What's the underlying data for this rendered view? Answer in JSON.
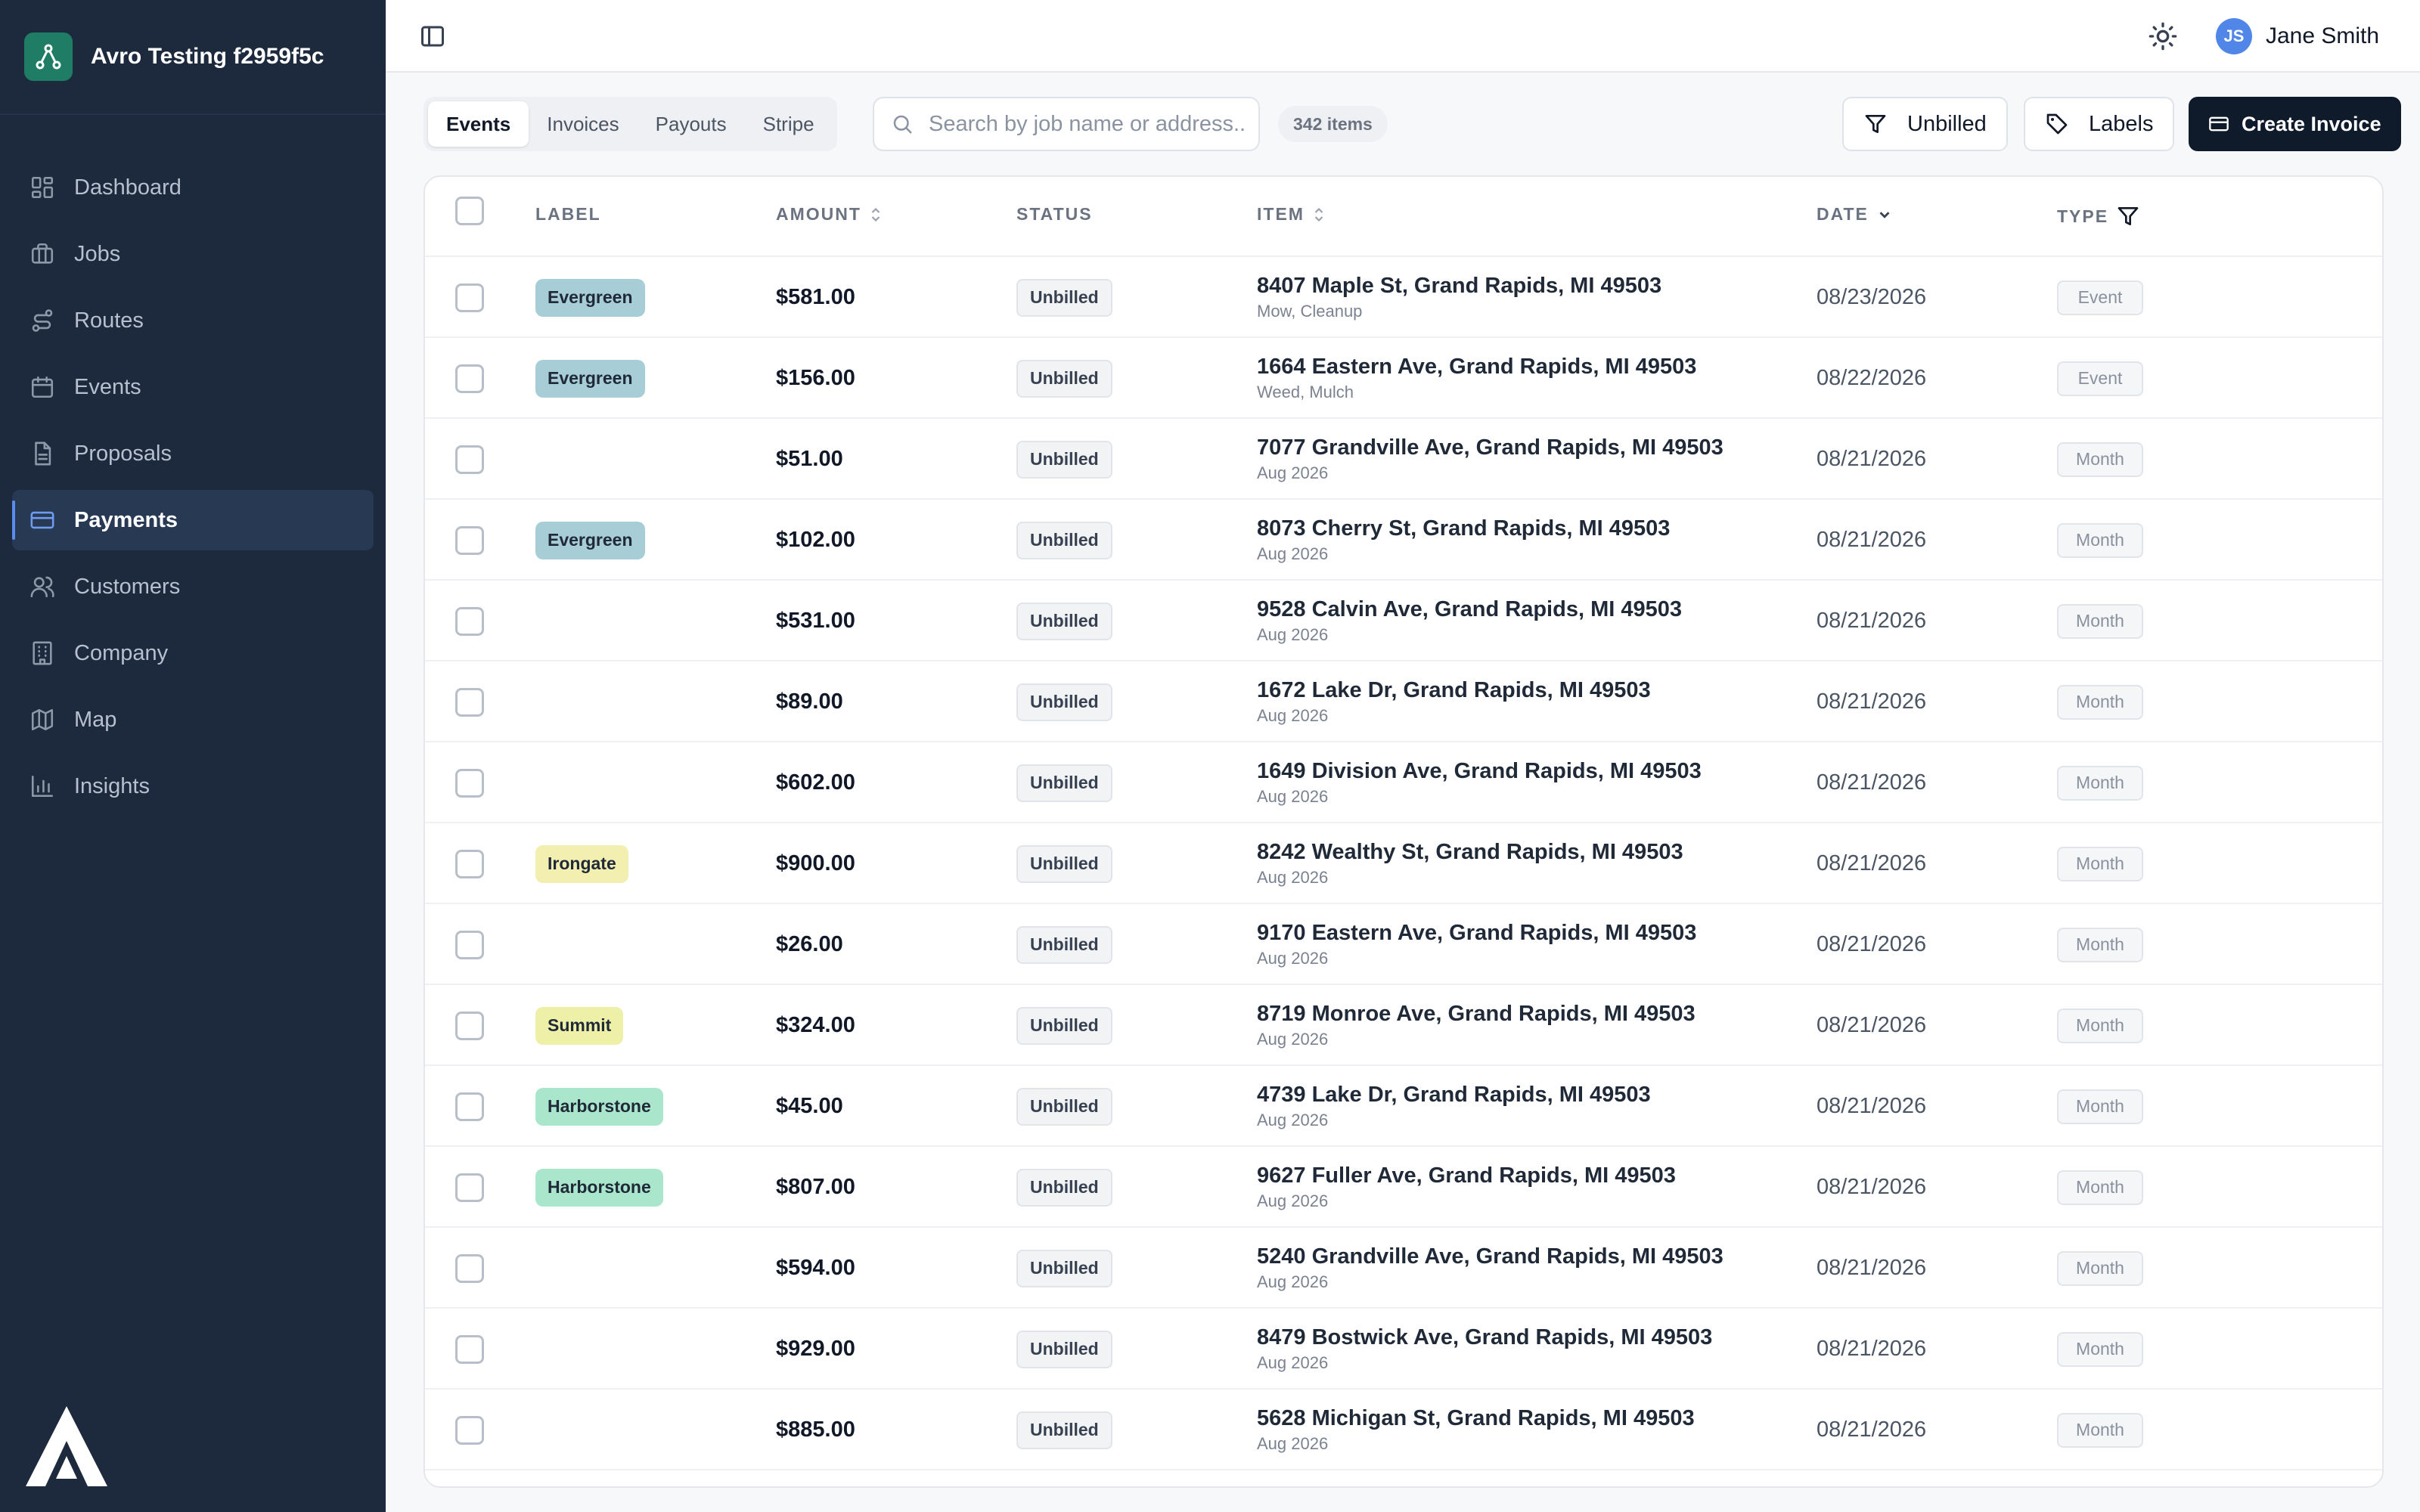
{
  "app": {
    "title": "Avro Testing f2959f5c",
    "user_name": "Jane Smith",
    "user_initials": "JS"
  },
  "colors": {
    "sidebar_bg": "#1d2a3e",
    "brand_green": "#1e7d64",
    "primary_button": "#0f1a2b",
    "avatar": "#4f86e8"
  },
  "sidebar": {
    "items": [
      {
        "label": "Dashboard",
        "icon": "dashboard-icon"
      },
      {
        "label": "Jobs",
        "icon": "briefcase-icon"
      },
      {
        "label": "Routes",
        "icon": "route-icon"
      },
      {
        "label": "Events",
        "icon": "calendar-icon"
      },
      {
        "label": "Proposals",
        "icon": "document-icon"
      },
      {
        "label": "Payments",
        "icon": "credit-card-icon",
        "active": true
      },
      {
        "label": "Customers",
        "icon": "users-icon"
      },
      {
        "label": "Company",
        "icon": "building-icon"
      },
      {
        "label": "Map",
        "icon": "map-icon"
      },
      {
        "label": "Insights",
        "icon": "bar-chart-icon"
      }
    ]
  },
  "toolbar": {
    "tabs": [
      "Events",
      "Invoices",
      "Payouts",
      "Stripe"
    ],
    "active_tab": "Events",
    "search_placeholder": "Search by job name or address...",
    "item_count": "342 items",
    "filter_label": "Unbilled",
    "labels_label": "Labels",
    "create_label": "Create Invoice"
  },
  "table": {
    "headers": {
      "label": "LABEL",
      "amount": "AMOUNT",
      "status": "STATUS",
      "item": "ITEM",
      "date": "DATE",
      "type": "TYPE"
    },
    "rows": [
      {
        "label": "Evergreen",
        "amount": "$581.00",
        "status": "Unbilled",
        "item": "8407 Maple St, Grand Rapids, MI 49503",
        "sub": "Mow, Cleanup",
        "date": "08/23/2026",
        "type": "Event"
      },
      {
        "label": "Evergreen",
        "amount": "$156.00",
        "status": "Unbilled",
        "item": "1664 Eastern Ave, Grand Rapids, MI 49503",
        "sub": "Weed, Mulch",
        "date": "08/22/2026",
        "type": "Event"
      },
      {
        "label": "",
        "amount": "$51.00",
        "status": "Unbilled",
        "item": "7077 Grandville Ave, Grand Rapids, MI 49503",
        "sub": "Aug 2026",
        "date": "08/21/2026",
        "type": "Month"
      },
      {
        "label": "Evergreen",
        "amount": "$102.00",
        "status": "Unbilled",
        "item": "8073 Cherry St, Grand Rapids, MI 49503",
        "sub": "Aug 2026",
        "date": "08/21/2026",
        "type": "Month"
      },
      {
        "label": "",
        "amount": "$531.00",
        "status": "Unbilled",
        "item": "9528 Calvin Ave, Grand Rapids, MI 49503",
        "sub": "Aug 2026",
        "date": "08/21/2026",
        "type": "Month"
      },
      {
        "label": "",
        "amount": "$89.00",
        "status": "Unbilled",
        "item": "1672 Lake Dr, Grand Rapids, MI 49503",
        "sub": "Aug 2026",
        "date": "08/21/2026",
        "type": "Month"
      },
      {
        "label": "",
        "amount": "$602.00",
        "status": "Unbilled",
        "item": "1649 Division Ave, Grand Rapids, MI 49503",
        "sub": "Aug 2026",
        "date": "08/21/2026",
        "type": "Month"
      },
      {
        "label": "Irongate",
        "amount": "$900.00",
        "status": "Unbilled",
        "item": "8242 Wealthy St, Grand Rapids, MI 49503",
        "sub": "Aug 2026",
        "date": "08/21/2026",
        "type": "Month"
      },
      {
        "label": "",
        "amount": "$26.00",
        "status": "Unbilled",
        "item": "9170 Eastern Ave, Grand Rapids, MI 49503",
        "sub": "Aug 2026",
        "date": "08/21/2026",
        "type": "Month"
      },
      {
        "label": "Summit",
        "amount": "$324.00",
        "status": "Unbilled",
        "item": "8719 Monroe Ave, Grand Rapids, MI 49503",
        "sub": "Aug 2026",
        "date": "08/21/2026",
        "type": "Month"
      },
      {
        "label": "Harborstone",
        "amount": "$45.00",
        "status": "Unbilled",
        "item": "4739 Lake Dr, Grand Rapids, MI 49503",
        "sub": "Aug 2026",
        "date": "08/21/2026",
        "type": "Month"
      },
      {
        "label": "Harborstone",
        "amount": "$807.00",
        "status": "Unbilled",
        "item": "9627 Fuller Ave, Grand Rapids, MI 49503",
        "sub": "Aug 2026",
        "date": "08/21/2026",
        "type": "Month"
      },
      {
        "label": "",
        "amount": "$594.00",
        "status": "Unbilled",
        "item": "5240 Grandville Ave, Grand Rapids, MI 49503",
        "sub": "Aug 2026",
        "date": "08/21/2026",
        "type": "Month"
      },
      {
        "label": "",
        "amount": "$929.00",
        "status": "Unbilled",
        "item": "8479 Bostwick Ave, Grand Rapids, MI 49503",
        "sub": "Aug 2026",
        "date": "08/21/2026",
        "type": "Month"
      },
      {
        "label": "",
        "amount": "$885.00",
        "status": "Unbilled",
        "item": "5628 Michigan St, Grand Rapids, MI 49503",
        "sub": "Aug 2026",
        "date": "08/21/2026",
        "type": "Month"
      }
    ]
  },
  "label_colors": {
    "Evergreen": "#a7cdd6",
    "Irongate": "#f2efb0",
    "Summit": "#eef0a8",
    "Harborstone": "#a9e6cc"
  }
}
